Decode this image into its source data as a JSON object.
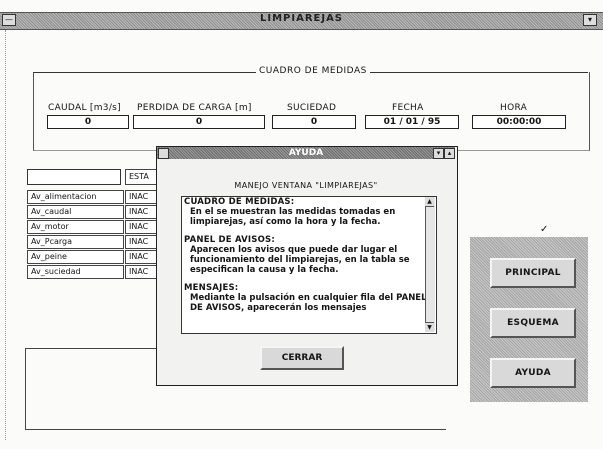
{
  "window": {
    "title": "LIMPIAREJAS",
    "sys_glyph": "—",
    "max_glyph": "▾"
  },
  "measures": {
    "group_title": "CUADRO DE MEDIDAS",
    "columns": [
      {
        "label": "CAUDAL [m3/s]",
        "value": "0"
      },
      {
        "label": "PERDIDA DE CARGA [m]",
        "value": "0"
      },
      {
        "label": "SUCIEDAD",
        "value": "0"
      },
      {
        "label": "FECHA",
        "value": "01 / 01 / 95"
      },
      {
        "label": "HORA",
        "value": "00:00:00"
      }
    ]
  },
  "alarms": {
    "state_header": "ESTA",
    "items": [
      {
        "name": "Av_alimentacion",
        "state": "INAC"
      },
      {
        "name": "Av_caudal",
        "state": "INAC"
      },
      {
        "name": "Av_motor",
        "state": "INAC"
      },
      {
        "name": "Av_Pcarga",
        "state": "INAC"
      },
      {
        "name": "Av_peine",
        "state": "INAC"
      },
      {
        "name": "Av_suciedad",
        "state": "INAC"
      }
    ]
  },
  "nav": {
    "principal": "PRINCIPAL",
    "esquema": "ESQUEMA",
    "ayuda": "AYUDA",
    "tick": "✓"
  },
  "dialog": {
    "title": "AYUDA",
    "heading": "MANEJO VENTANA \"LIMPIAREJAS\"",
    "paragraphs": [
      {
        "head": "CUADRO DE MEDIDAS:",
        "body": "En el se muestran las medidas tomadas en limpiarejas, así como la hora y la fecha."
      },
      {
        "head": "PANEL DE AVISOS:",
        "body": "Aparecen los avisos que puede dar lugar el funcionamiento del limpiarejas, en la tabla se especifican la causa y la fecha."
      },
      {
        "head": "MENSAJES:",
        "body": "Mediante la pulsación en cualquier fila del PANEL DE AVISOS, aparecerán los mensajes"
      }
    ],
    "close_label": "CERRAR",
    "min_glyph": "▾",
    "max_glyph": "▴",
    "scroll_up": "▲",
    "scroll_down": "▼"
  }
}
